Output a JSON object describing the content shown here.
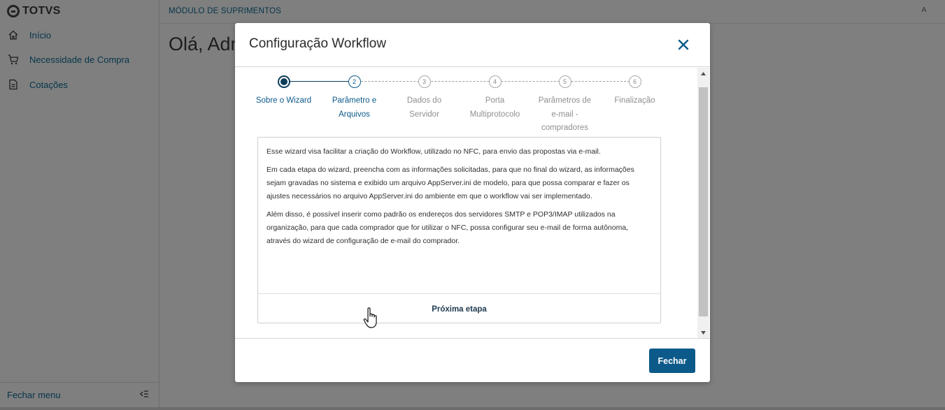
{
  "app": {
    "logo_text": "TOTVS",
    "module_title": "MÓDULO DE SUPRIMENTOS",
    "greeting": "Olá, Adm",
    "user_initial": "A"
  },
  "sidebar": {
    "items": [
      {
        "label": "Início",
        "icon": "home-icon"
      },
      {
        "label": "Necessidade de Compra",
        "icon": "cart-icon"
      },
      {
        "label": "Cotações",
        "icon": "document-icon"
      }
    ],
    "footer_label": "Fechar menu",
    "footer_icon": "collapse-menu-icon"
  },
  "modal": {
    "title": "Configuração Workflow",
    "close_icon": "close-icon",
    "steps": [
      {
        "number": "1",
        "label": "Sobre o Wizard",
        "state": "done"
      },
      {
        "number": "2",
        "label": "Parâmetro e Arquivos",
        "state": "active"
      },
      {
        "number": "3",
        "label": "Dados do Servidor",
        "state": "pending"
      },
      {
        "number": "4",
        "label": "Porta Multiprotocolo",
        "state": "pending"
      },
      {
        "number": "5",
        "label": "Parâmetros de e-mail - compradores",
        "state": "pending"
      },
      {
        "number": "6",
        "label": "Finalização",
        "state": "pending"
      }
    ],
    "paragraphs": [
      "Esse wizard visa facilitar a criação do Workflow, utilizado no NFC, para envio das propostas via e-mail.",
      "Em cada etapa do wizard, preencha com as informações solicitadas, para que no final do wizard, as informações sejam gravadas no sistema e exibido um arquivo AppServer.ini de modelo, para que possa comparar e fazer os ajustes necessários no arquivo AppServer.ini do ambiente em que o workflow vai ser implementado.",
      "Além disso, é possível inserir como padrão os endereços dos servidores SMTP e POP3/IMAP utilizados na organização, para que cada comprador que for utilizar o NFC, possa configurar seu e-mail de forma autônoma, através do wizard de configuração de e-mail do comprador."
    ],
    "next_button": "Próxima etapa",
    "close_button": "Fechar"
  },
  "colors": {
    "primary": "#0c5a8a",
    "link": "#0c6c94",
    "overlay": "rgba(0,0,0,0.5)"
  }
}
